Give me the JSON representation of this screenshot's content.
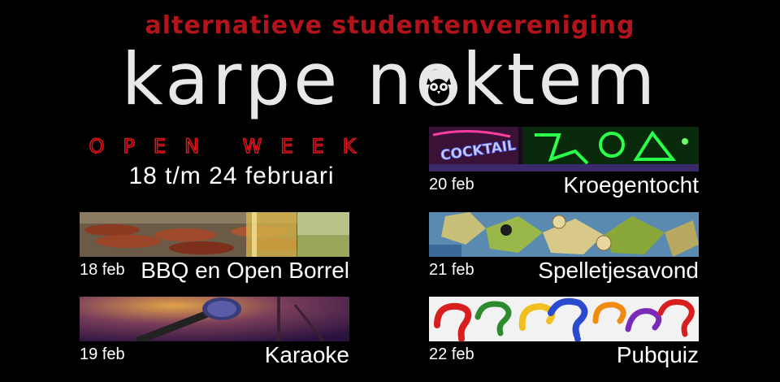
{
  "header": {
    "subtitle": "alternatieve studentenvereniging",
    "logo": "karpe noktem"
  },
  "intro": {
    "open_week": "OPEN WEEK",
    "dates": "18 t/m 24 februari"
  },
  "events": [
    {
      "date": "18 feb",
      "name": "BBQ en Open Borrel",
      "image": "bbq-photo"
    },
    {
      "date": "19 feb",
      "name": "Karaoke",
      "image": "microphone-photo"
    },
    {
      "date": "20 feb",
      "name": "Kroegentocht",
      "image": "neon-cocktail-sign-photo",
      "image_text": "COCKTAIL"
    },
    {
      "date": "21 feb",
      "name": "Spelletjesavond",
      "image": "board-game-photo"
    },
    {
      "date": "22 feb",
      "name": "Pubquiz",
      "image": "question-marks-photo"
    }
  ],
  "colors": {
    "background": "#000000",
    "accent_red": "#b3141b",
    "logo": "#e8e8e8",
    "text": "#ffffff"
  }
}
